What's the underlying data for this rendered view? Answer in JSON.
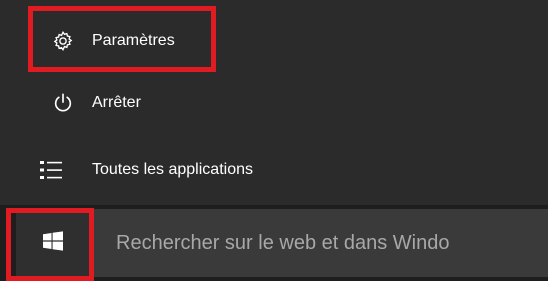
{
  "start_menu": {
    "items": [
      {
        "label": "Paramètres",
        "icon": "gear-icon"
      },
      {
        "label": "Arrêter",
        "icon": "power-icon"
      },
      {
        "label": "Toutes les applications",
        "icon": "list-icon"
      }
    ]
  },
  "taskbar": {
    "start_icon": "windows-logo-icon",
    "search_placeholder": "Rechercher sur le web et dans Windo"
  },
  "colors": {
    "menu_background": "#2b2b2b",
    "taskbar_background": "#1e1e1e",
    "search_background": "#3a3a3a",
    "highlight": "#e01b22",
    "text": "#ffffff",
    "placeholder_text": "#a8a8a8"
  }
}
